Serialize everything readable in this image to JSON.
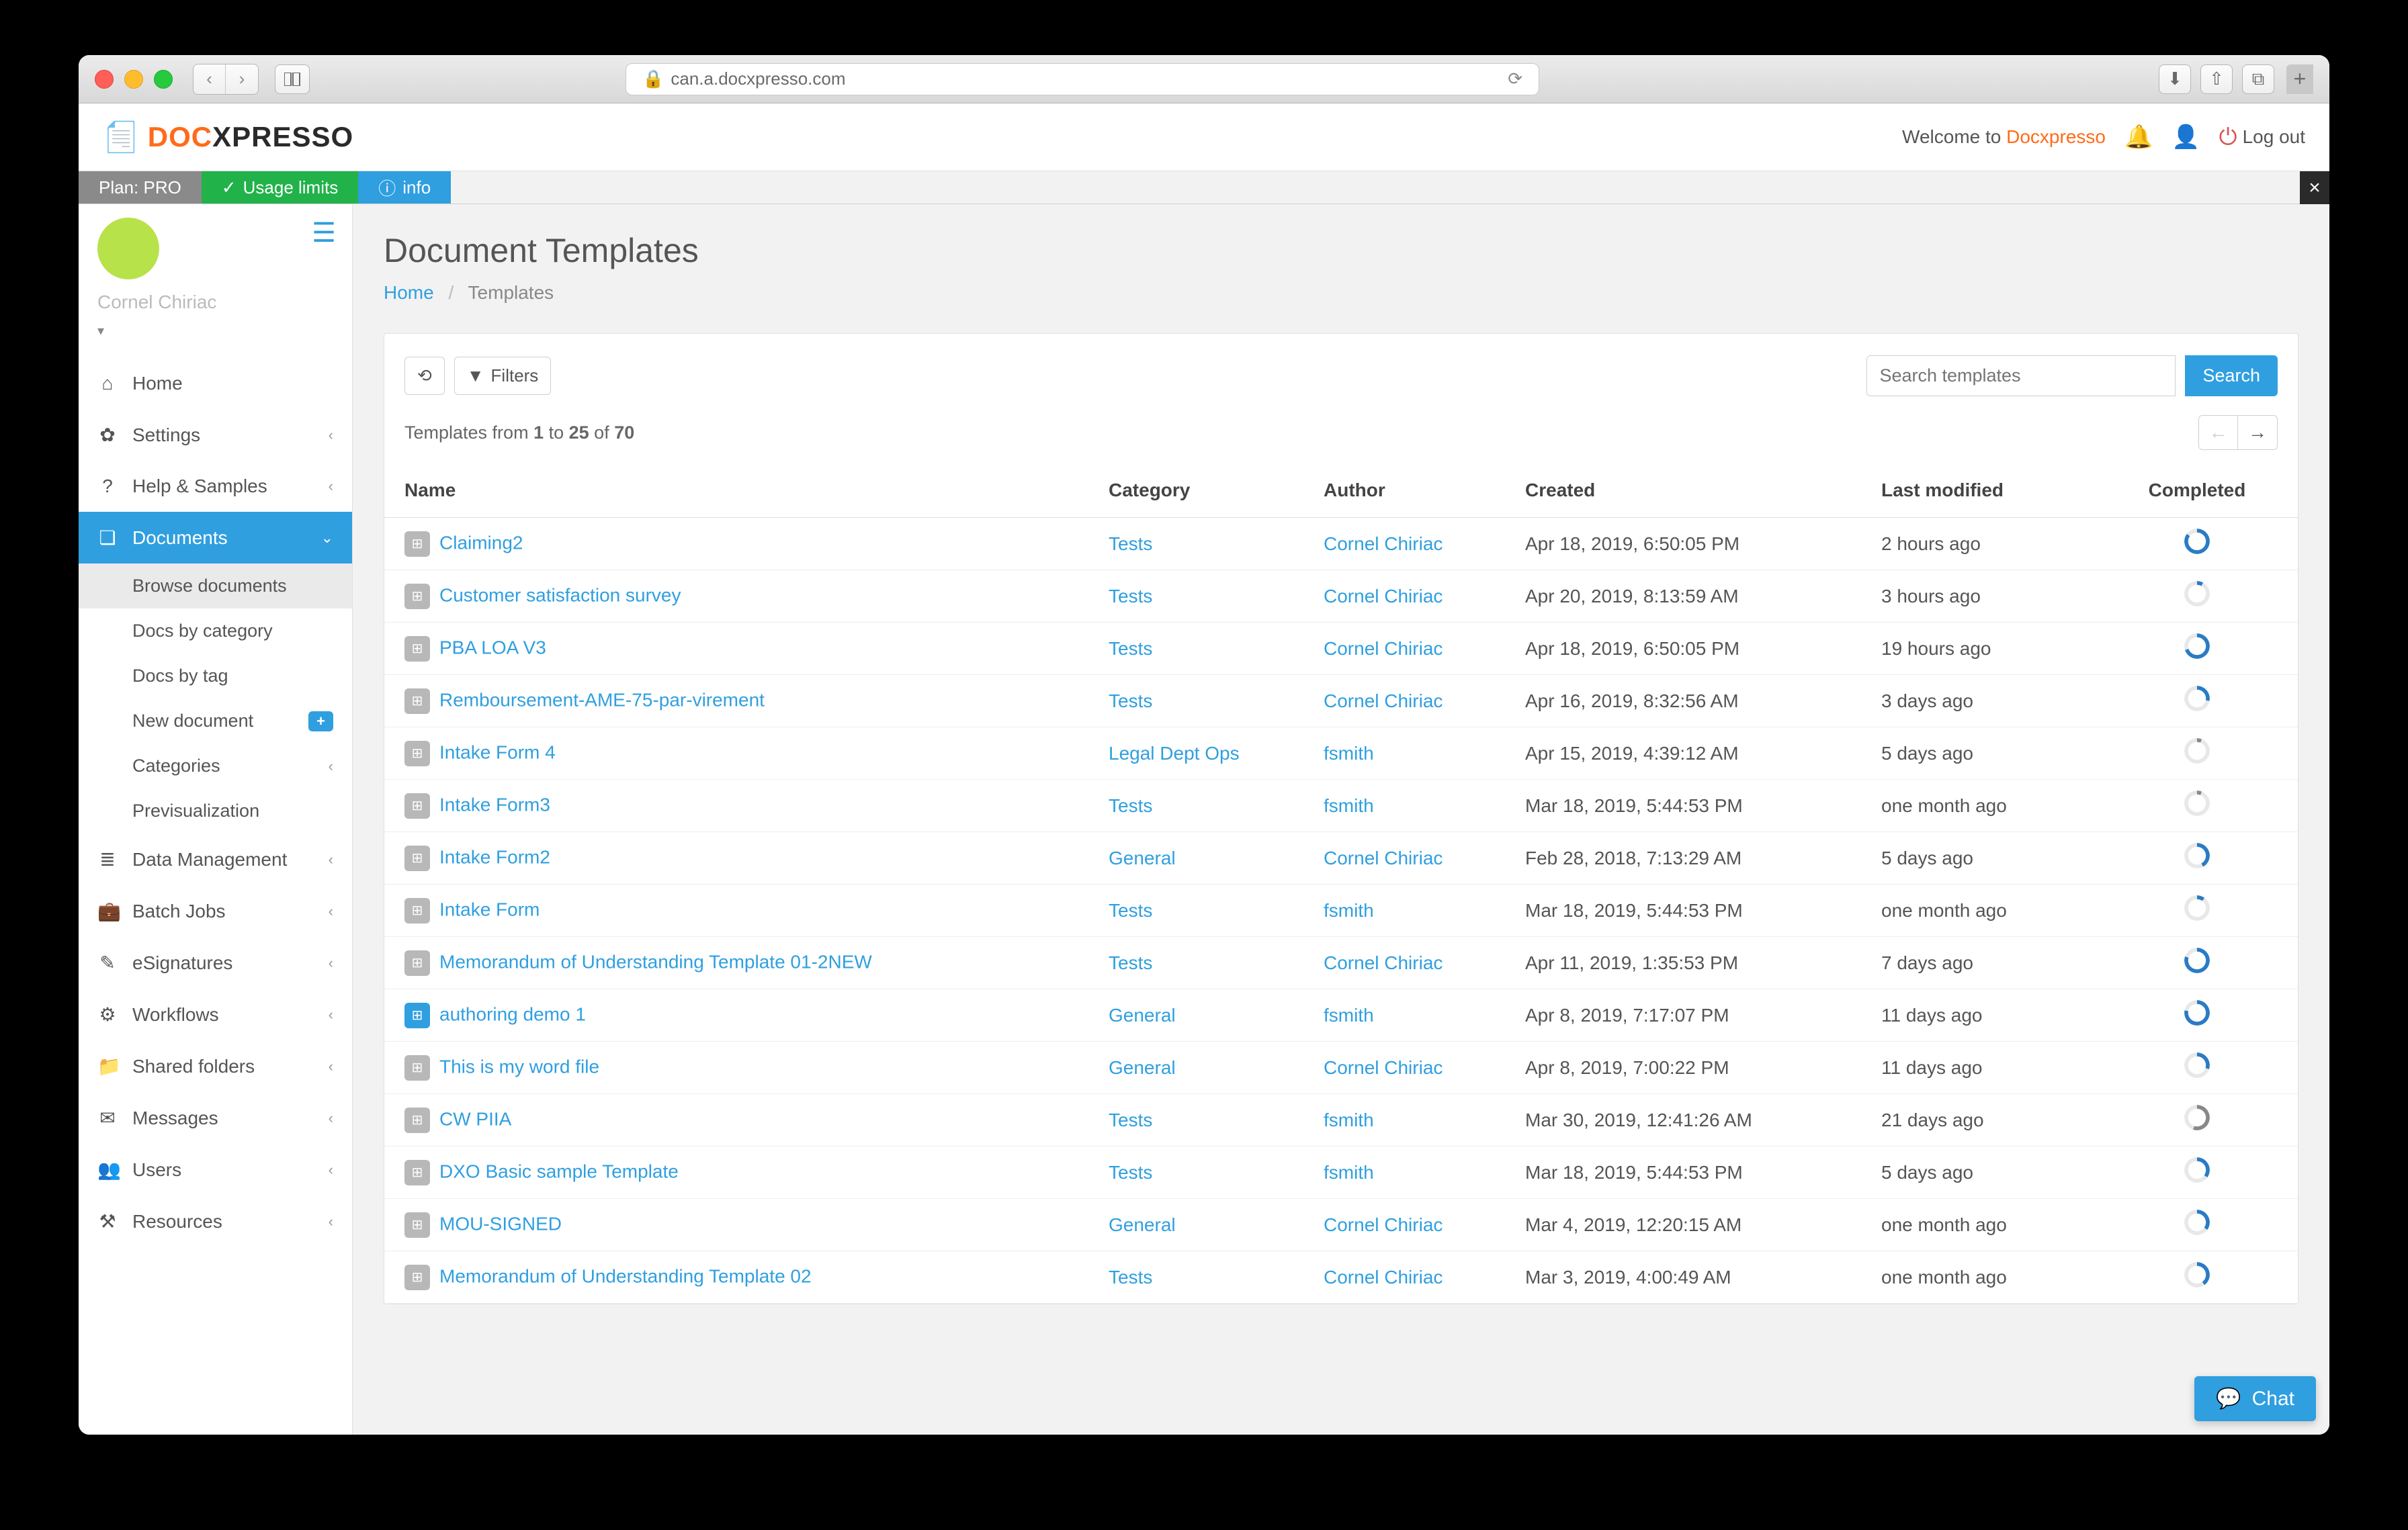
{
  "browser": {
    "url": "can.a.docxpresso.com"
  },
  "brand": {
    "part1": "DOC",
    "part2": "XPRESSO"
  },
  "header": {
    "welcome_prefix": "Welcome to ",
    "welcome_link": "Docxpresso",
    "logout": "Log out"
  },
  "ribbon": {
    "plan_label": "Plan: PRO",
    "usage": "Usage limits",
    "info": "info"
  },
  "user": {
    "name": "Cornel Chiriac"
  },
  "sidebar": {
    "home": "Home",
    "settings": "Settings",
    "help": "Help & Samples",
    "documents": "Documents",
    "browse": "Browse documents",
    "docs_cat": "Docs by category",
    "docs_tag": "Docs by tag",
    "new_doc": "New document",
    "categories": "Categories",
    "previs": "Previsualization",
    "data_mgmt": "Data Management",
    "batch": "Batch Jobs",
    "esig": "eSignatures",
    "workflows": "Workflows",
    "shared": "Shared folders",
    "messages": "Messages",
    "users": "Users",
    "resources": "Resources"
  },
  "page": {
    "title": "Document Templates",
    "bc_home": "Home",
    "bc_current": "Templates"
  },
  "toolbar": {
    "filters": "Filters",
    "search_placeholder": "Search templates",
    "search_btn": "Search",
    "count_prefix": "Templates from ",
    "from": "1",
    "to_word": " to ",
    "to": "25",
    "of_word": " of ",
    "total": "70"
  },
  "columns": {
    "name": "Name",
    "category": "Category",
    "author": "Author",
    "created": "Created",
    "modified": "Last modified",
    "completed": "Completed"
  },
  "rows": [
    {
      "name": "Claiming2",
      "cat": "Tests",
      "author": "Cornel Chiriac",
      "created": "Apr 18, 2019, 6:50:05 PM",
      "mod": "2 hours ago",
      "comp": 85,
      "color": "#2a7bc4"
    },
    {
      "name": "Customer satisfaction survey",
      "cat": "Tests",
      "author": "Cornel Chiriac",
      "created": "Apr 20, 2019, 8:13:59 AM",
      "mod": "3 hours ago",
      "comp": 8,
      "color": "#2a7bc4"
    },
    {
      "name": "PBA LOA V3",
      "cat": "Tests",
      "author": "Cornel Chiriac",
      "created": "Apr 18, 2019, 6:50:05 PM",
      "mod": "19 hours ago",
      "comp": 70,
      "color": "#2a7bc4"
    },
    {
      "name": "Remboursement-AME-75-par-virement",
      "cat": "Tests",
      "author": "Cornel Chiriac",
      "created": "Apr 16, 2019, 8:32:56 AM",
      "mod": "3 days ago",
      "comp": 28,
      "color": "#2a7bc4"
    },
    {
      "name": "Intake Form 4",
      "cat": "Legal Dept Ops",
      "author": "fsmith",
      "created": "Apr 15, 2019, 4:39:12 AM",
      "mod": "5 days ago",
      "comp": 6,
      "color": "#888"
    },
    {
      "name": "Intake Form3",
      "cat": "Tests",
      "author": "fsmith",
      "created": "Mar 18, 2019, 5:44:53 PM",
      "mod": "one month ago",
      "comp": 6,
      "color": "#888"
    },
    {
      "name": "Intake Form2",
      "cat": "General",
      "author": "Cornel Chiriac",
      "created": "Feb 28, 2018, 7:13:29 AM",
      "mod": "5 days ago",
      "comp": 42,
      "color": "#2a7bc4"
    },
    {
      "name": "Intake Form",
      "cat": "Tests",
      "author": "fsmith",
      "created": "Mar 18, 2019, 5:44:53 PM",
      "mod": "one month ago",
      "comp": 10,
      "color": "#2a7bc4"
    },
    {
      "name": "Memorandum of Understanding Template 01-2NEW",
      "cat": "Tests",
      "author": "Cornel Chiriac",
      "created": "Apr 11, 2019, 1:35:53 PM",
      "mod": "7 days ago",
      "comp": 80,
      "color": "#2a7bc4"
    },
    {
      "name": "authoring demo 1",
      "cat": "General",
      "author": "fsmith",
      "created": "Apr 8, 2019, 7:17:07 PM",
      "mod": "11 days ago",
      "comp": 78,
      "color": "#2a7bc4",
      "blue": true
    },
    {
      "name": "This is my word file",
      "cat": "General",
      "author": "Cornel Chiriac",
      "created": "Apr 8, 2019, 7:00:22 PM",
      "mod": "11 days ago",
      "comp": 30,
      "color": "#2a7bc4"
    },
    {
      "name": "CW PIIA",
      "cat": "Tests",
      "author": "fsmith",
      "created": "Mar 30, 2019, 12:41:26 AM",
      "mod": "21 days ago",
      "comp": 55,
      "color": "#888"
    },
    {
      "name": "DXO Basic sample Template",
      "cat": "Tests",
      "author": "fsmith",
      "created": "Mar 18, 2019, 5:44:53 PM",
      "mod": "5 days ago",
      "comp": 35,
      "color": "#2a7bc4"
    },
    {
      "name": "MOU-SIGNED",
      "cat": "General",
      "author": "Cornel Chiriac",
      "created": "Mar 4, 2019, 12:20:15 AM",
      "mod": "one month ago",
      "comp": 35,
      "color": "#2a7bc4"
    },
    {
      "name": "Memorandum of Understanding Template 02",
      "cat": "Tests",
      "author": "Cornel Chiriac",
      "created": "Mar 3, 2019, 4:00:49 AM",
      "mod": "one month ago",
      "comp": 40,
      "color": "#2a7bc4"
    }
  ],
  "chat": {
    "label": "Chat"
  }
}
